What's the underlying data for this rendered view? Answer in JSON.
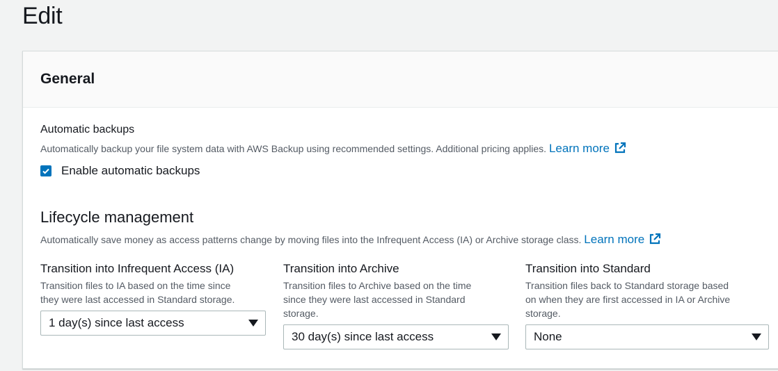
{
  "page": {
    "title": "Edit"
  },
  "panel": {
    "title": "General"
  },
  "backups": {
    "label": "Automatic backups",
    "description": "Automatically backup your file system data with AWS Backup using recommended settings. Additional pricing applies.",
    "learn_more": "Learn more",
    "checkbox_label": "Enable automatic backups",
    "checked": true
  },
  "lifecycle": {
    "heading": "Lifecycle management",
    "description": "Automatically save money as access patterns change by moving files into the Infrequent Access (IA) or Archive storage class.",
    "learn_more": "Learn more",
    "fields": [
      {
        "label": "Transition into Infrequent Access (IA)",
        "desc1": "Transition files to IA based on the time since",
        "desc2": "they were last accessed in Standard storage.",
        "desc3": "",
        "value": "1 day(s) since last access"
      },
      {
        "label": "Transition into Archive",
        "desc1": "Transition files to Archive based on the time",
        "desc2": "since they were last accessed in Standard",
        "desc3": "storage.",
        "value": "30 day(s) since last access"
      },
      {
        "label": "Transition into Standard",
        "desc1": "Transition files back to Standard storage based",
        "desc2": "on when they are first accessed in IA or Archive",
        "desc3": "storage.",
        "value": "None"
      }
    ]
  },
  "colors": {
    "link": "#0073bb",
    "checkbox": "#0073bb",
    "text": "#16191f",
    "muted": "#545b64"
  }
}
